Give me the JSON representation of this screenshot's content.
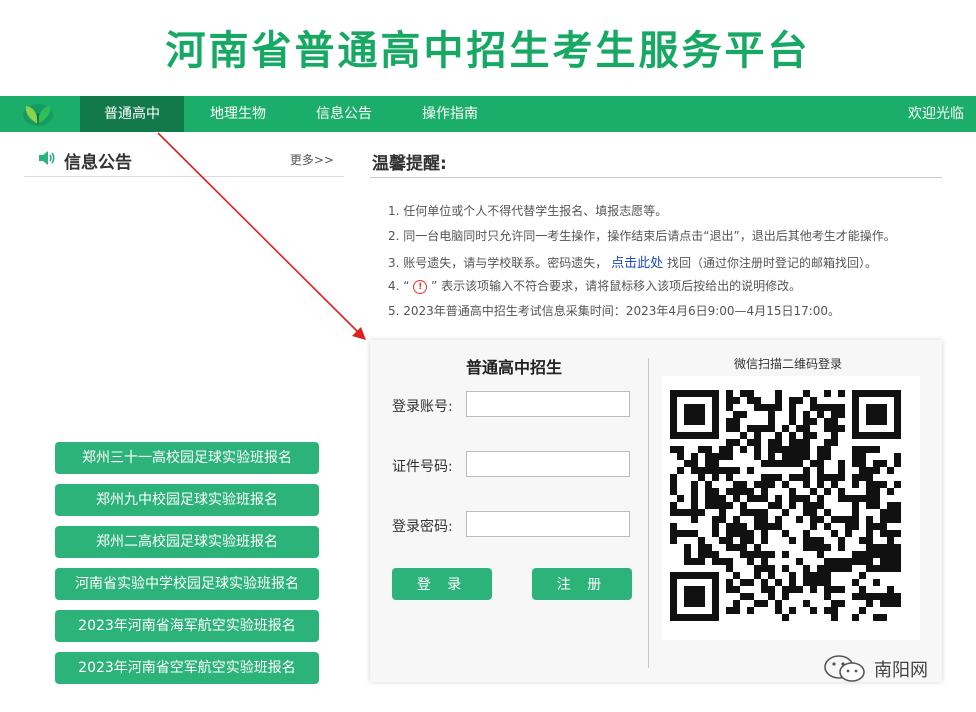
{
  "header": {
    "title": "河南省普通高中招生考生服务平台"
  },
  "nav": {
    "items": [
      {
        "label": "普通高中"
      },
      {
        "label": "地理生物"
      },
      {
        "label": "信息公告"
      },
      {
        "label": "操作指南"
      }
    ],
    "welcome": "欢迎光临"
  },
  "notice": {
    "title": "信息公告",
    "more": "更多>>"
  },
  "tips": {
    "title": "温馨提醒:",
    "items": [
      "1. 任何单位或个人不得代替学生报名、填报志愿等。",
      "2. 同一台电脑同时只允许同一考生操作，操作结束后请点击“退出”，退出后其他考生才能操作。",
      "5. 2023年普通高中招生考试信息采集时间：2023年4月6日9:00—4月15日17:00。"
    ],
    "tip3_prefix": "3. 账号遗失，请与学校联系。密码遗失，",
    "tip3_link": "点击此处",
    "tip3_suffix": "找回（通过你注册时登记的邮箱找回）。",
    "tip4_prefix": "4. “",
    "tip4_icon": "!",
    "tip4_suffix": "” 表示该项输入不符合要求，请将鼠标移入该项后按给出的说明修改。"
  },
  "side_links": [
    "郑州三十一高校园足球实验班报名",
    "郑州九中校园足球实验班报名",
    "郑州二高校园足球实验班报名",
    "河南省实验中学校园足球实验班报名",
    "2023年河南省海军航空实验班报名",
    "2023年河南省空军航空实验班报名"
  ],
  "login": {
    "title": "普通高中招生",
    "account_label": "登录账号:",
    "id_label": "证件号码:",
    "password_label": "登录密码:",
    "login_button": "登 录",
    "register_button": "注 册",
    "qr_caption": "微信扫描二维码登录"
  },
  "watermark": {
    "text": "南阳网"
  },
  "colors": {
    "brand": "#1aae6a",
    "button": "#2cb37a",
    "nav_active": "#127a4a",
    "link": "#1a49c8"
  }
}
